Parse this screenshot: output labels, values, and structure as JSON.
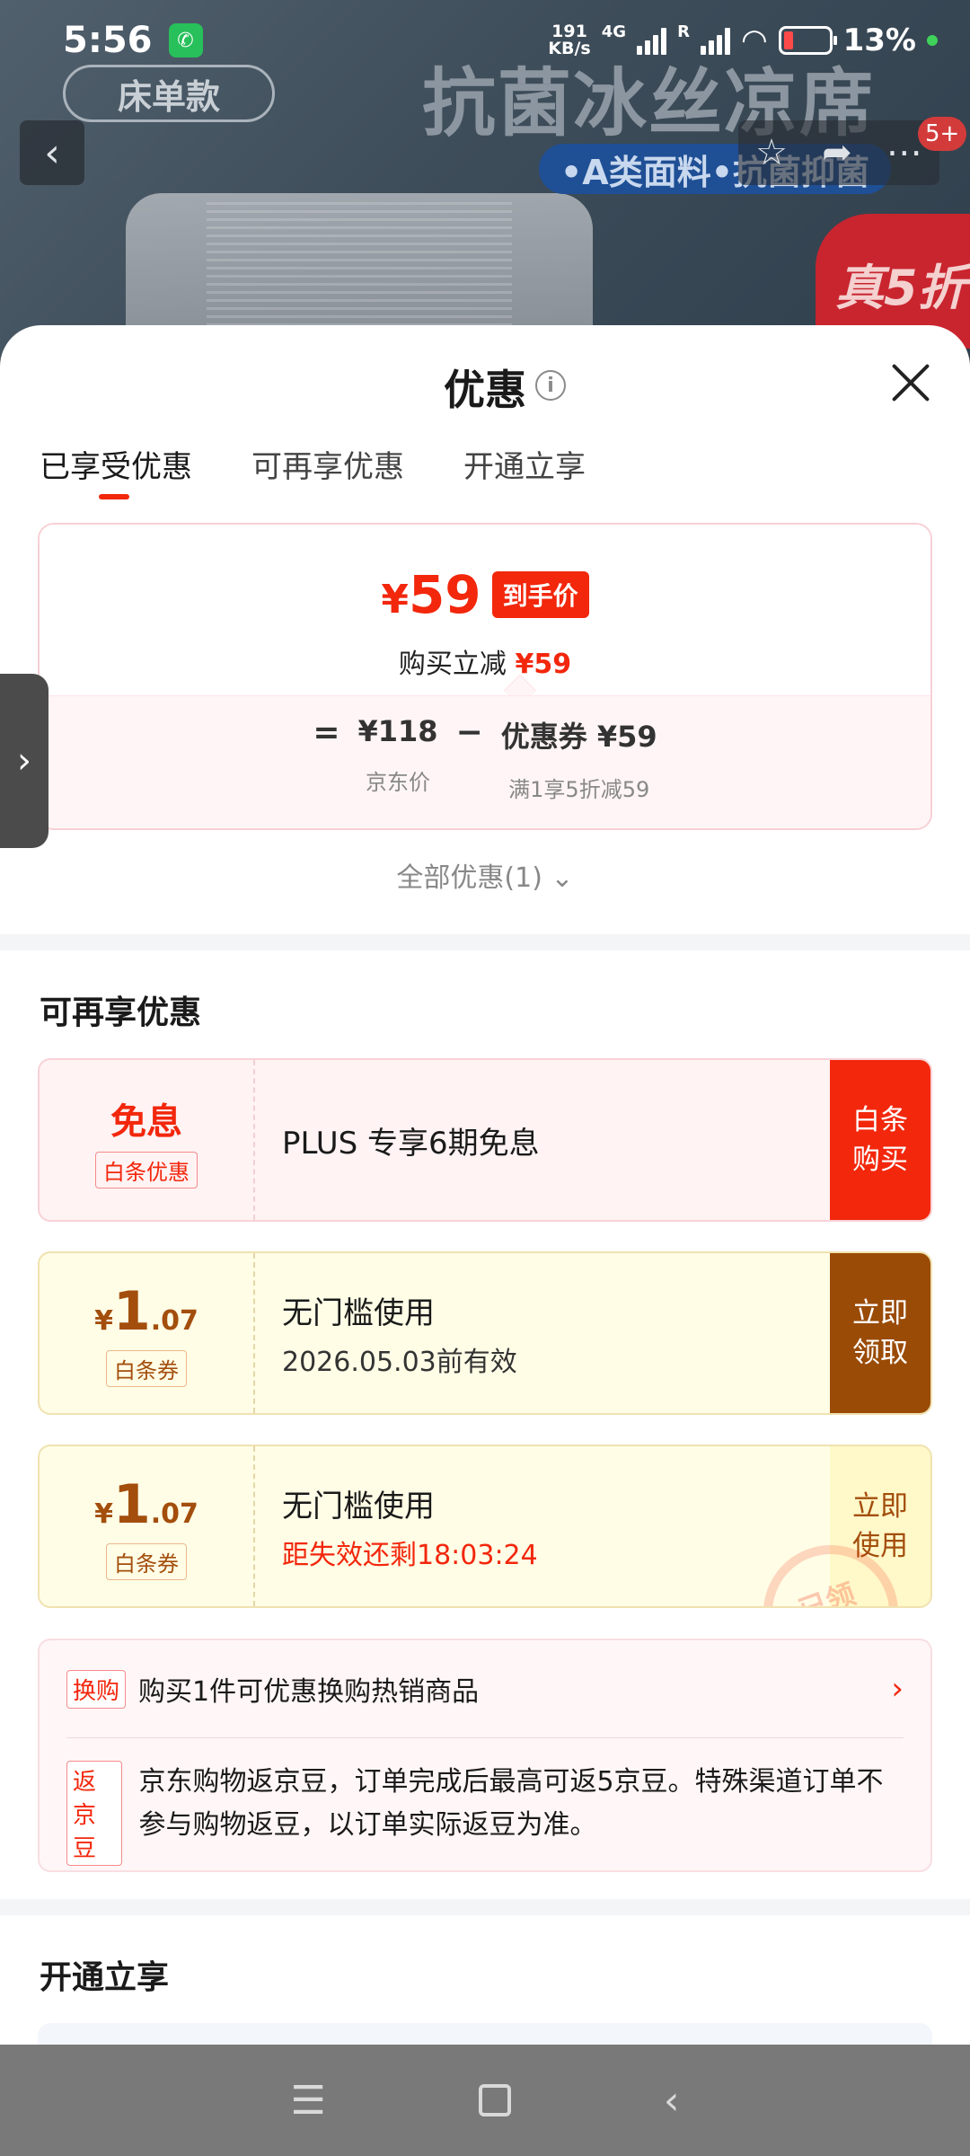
{
  "status_bar": {
    "time": "5:56",
    "net_speed_value": "191",
    "net_speed_unit": "KB/s",
    "network": "4G",
    "roaming": "R",
    "battery": "13%"
  },
  "hero": {
    "bed_tag": "床单款",
    "title": "抗菌冰丝凉席",
    "subtitle": "•A类面料•抗菌抑菌",
    "discount": "真5折",
    "badge": "5+"
  },
  "sheet": {
    "title": "优惠",
    "tabs": [
      "已享受优惠",
      "可再享优惠",
      "开通立享"
    ],
    "price": {
      "yen": "¥",
      "final": "59",
      "final_tag": "到手价",
      "reduce_label": "购买立减",
      "reduce_value": "¥59",
      "eq": "=",
      "base_value": "¥118",
      "base_label": "京东价",
      "minus": "−",
      "coupon_value": "优惠券 ¥59",
      "coupon_label": "满1享5折减59"
    },
    "all_discounts": "全部优惠(1) ⌄",
    "section_more": "可再享优惠",
    "coupons": [
      {
        "left_main": "免息",
        "left_tag": "白条优惠",
        "title": "PLUS 专享6期免息",
        "button": "白条购买"
      },
      {
        "yen": "¥",
        "int": "1",
        "dec": ".07",
        "left_tag": "白条券",
        "title": "无门槛使用",
        "sub": "2026.05.03前有效",
        "button": "立即领取"
      },
      {
        "yen": "¥",
        "int": "1",
        "dec": ".07",
        "left_tag": "白条券",
        "title": "无门槛使用",
        "sub": "距失效还剩18:03:24",
        "button": "立即使用",
        "stamp": "已领"
      }
    ],
    "extra": {
      "swap_tag": "换购",
      "swap_text": "购买1件可优惠换购热销商品",
      "bean_tag": "返京豆",
      "bean_text": "京东购物返京豆，订单完成后最高可返5京豆。特殊渠道订单不参与购物返豆，以订单实际返豆为准。"
    },
    "section_open": "开通立享"
  },
  "icons": {
    "back": "chevron-left-icon",
    "favorite": "star-icon",
    "share": "share-icon",
    "more": "more-icon",
    "info": "info-icon",
    "close": "close-icon",
    "expand": "chevron-right-icon",
    "nav_menu": "menu-icon",
    "nav_home": "home-icon",
    "nav_back": "back-icon"
  },
  "colors": {
    "accent_red": "#f2270c",
    "coupon_brown": "#9a4b06"
  }
}
